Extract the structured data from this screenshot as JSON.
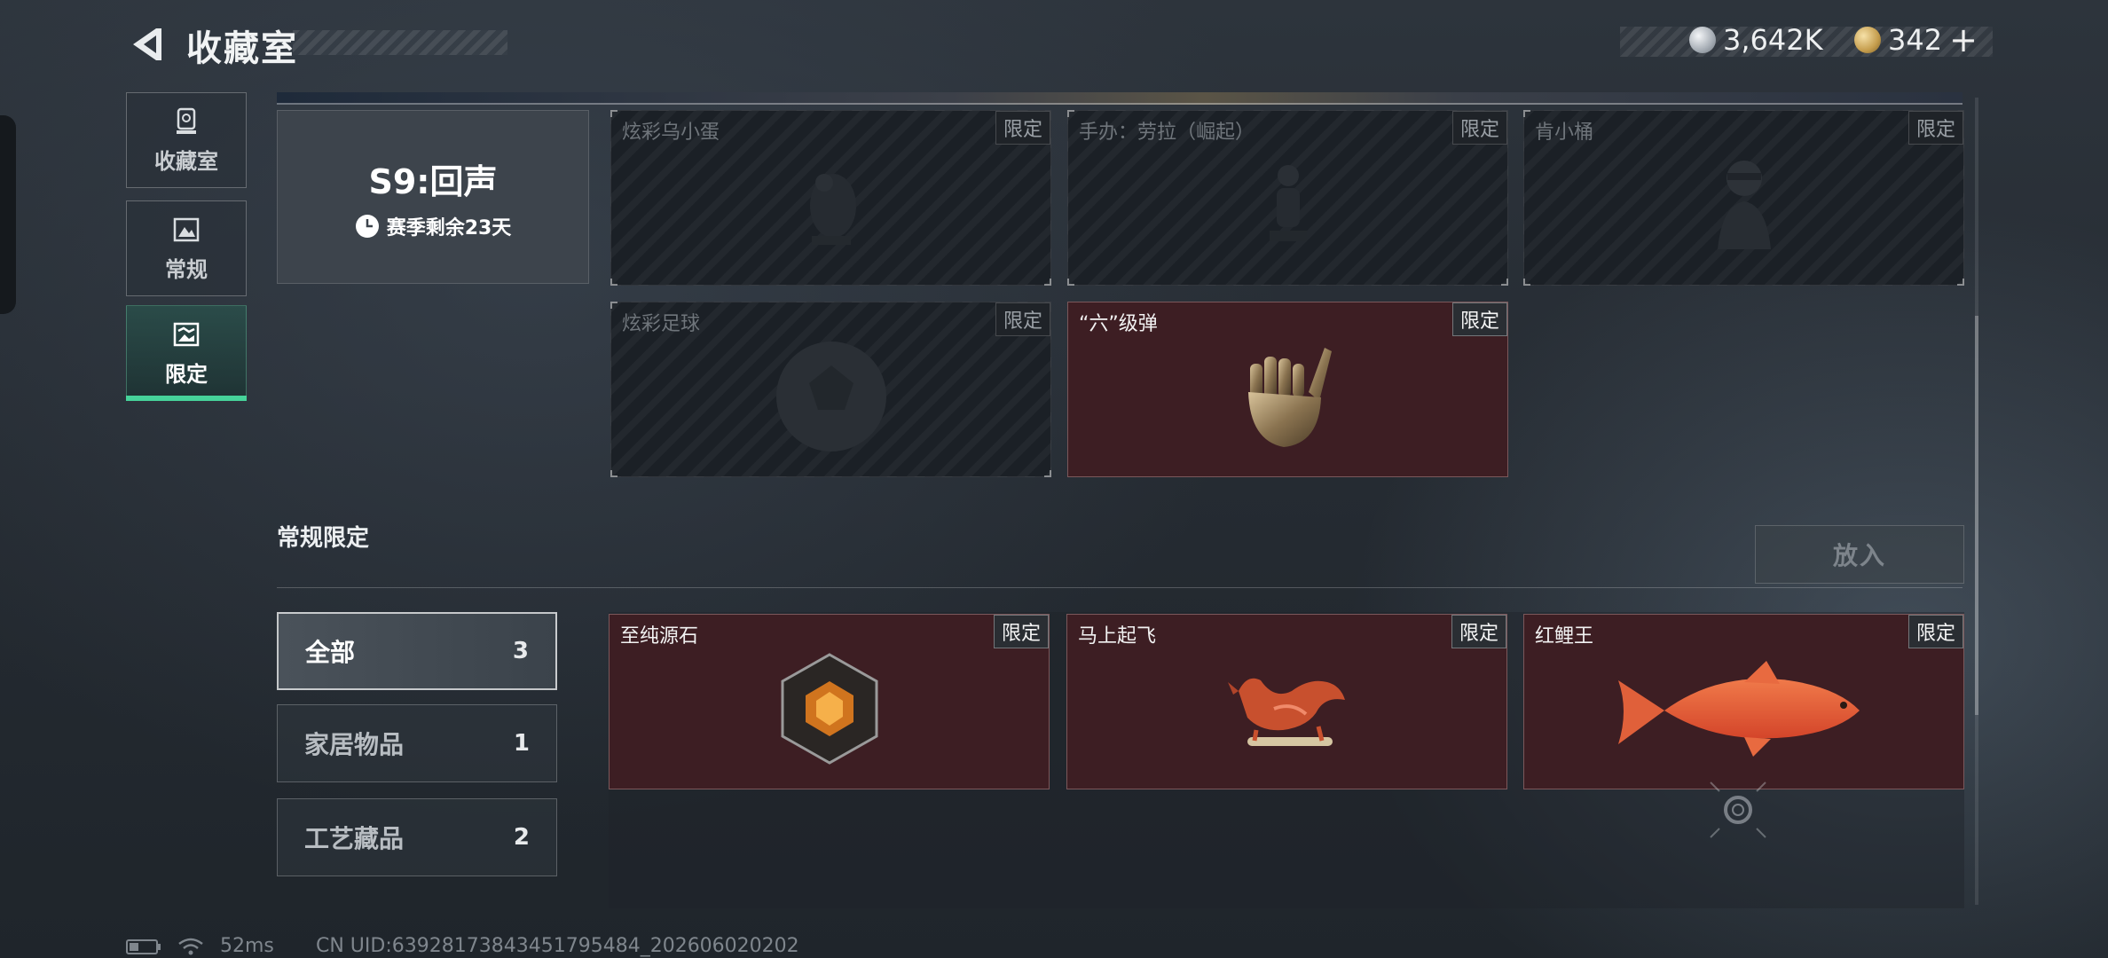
{
  "header": {
    "title": "收藏室",
    "currency_silver": "3,642K",
    "currency_gold": "342",
    "plus": "+"
  },
  "sidebar": {
    "items": [
      {
        "label": "收藏室",
        "icon": "trophy-icon"
      },
      {
        "label": "常规",
        "icon": "picture-icon"
      },
      {
        "label": "限定",
        "icon": "limited-picture-icon",
        "active": true
      }
    ]
  },
  "season": {
    "name": "S9:回声",
    "remaining": "赛季剩余23天"
  },
  "limited_items": [
    {
      "name": "炫彩乌小蛋",
      "tag": "限定",
      "owned": false
    },
    {
      "name": "手办：劳拉（崛起）",
      "tag": "限定",
      "owned": false
    },
    {
      "name": "肯小桶",
      "tag": "限定",
      "owned": false
    },
    {
      "name": "炫彩足球",
      "tag": "限定",
      "owned": false
    },
    {
      "name": "“六”级弹",
      "tag": "限定",
      "owned": true
    }
  ],
  "regular_limited": {
    "title": "常规限定",
    "place_button": "放入",
    "filters": [
      {
        "label": "全部",
        "count": "3",
        "active": true
      },
      {
        "label": "家居物品",
        "count": "1"
      },
      {
        "label": "工艺藏品",
        "count": "2"
      }
    ],
    "items": [
      {
        "name": "至纯源石",
        "tag": "限定"
      },
      {
        "name": "马上起飞",
        "tag": "限定"
      },
      {
        "name": "红鲤王",
        "tag": "限定"
      }
    ]
  },
  "footer": {
    "latency": "52ms",
    "uid": "CN UID:63928173843451795484_202606020202"
  },
  "colors": {
    "accent": "#46d39a",
    "owned_card": "#3d1e23",
    "locked_card": "#1b2026"
  }
}
